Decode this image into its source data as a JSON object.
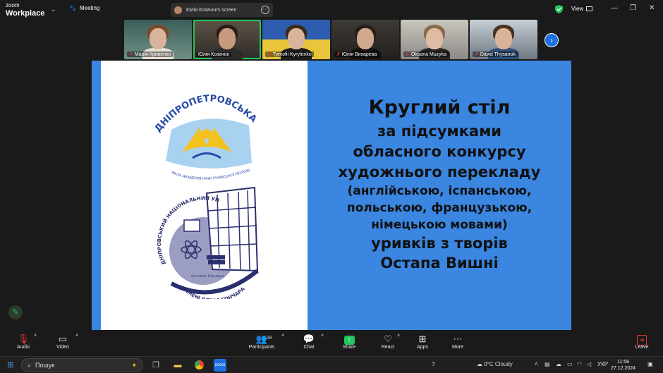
{
  "app": {
    "brand_top": "zoom",
    "brand_bottom": "Workplace",
    "meeting_label": "Meeting"
  },
  "screen_share": {
    "label": "Юлія Козачок's screen"
  },
  "top_right": {
    "view_label": "View"
  },
  "participants": [
    {
      "name": "Марія Кривенко",
      "muted": true
    },
    {
      "name": "Юлія Козачок",
      "muted": false
    },
    {
      "name": "Tymofii Kyrylenko",
      "muted": true
    },
    {
      "name": "Юлія Вихарева",
      "muted": true
    },
    {
      "name": "Oksana Muzyka",
      "muted": true
    },
    {
      "name": "David Thysanok",
      "muted": true
    }
  ],
  "slide": {
    "line1": "Круглий стіл",
    "line2": "за підсумками",
    "line3": "обласного конкурсу",
    "line4": "художнього перекладу",
    "line5": "(англійською, іспанською,",
    "line6": "польською, французькою,",
    "line7": "німецькою мовами)",
    "line8": "уривків з творів",
    "line9": "Остапа Вишні",
    "logo1_title": "ДНІПРОПЕТРОВСЬКА",
    "logo1_sub": "МАЛА АКАДЕМІЯ НАУК УЧНІВСЬКОЇ МОЛОДІ",
    "logo2_top": "ДНІПРОВСЬКИЙ НАЦІОНАЛЬНИЙ УНІВЕРСИТЕТ",
    "logo2_bottom": "ІМЕНІ ОЛЕСЯ ГОНЧАРА",
    "logo2_motto": "Docendo Discimus"
  },
  "toolbar": {
    "audio": "Audio",
    "video": "Video",
    "participants": "Participants",
    "participants_count": "38",
    "chat": "Chat",
    "share": "Share",
    "react": "React",
    "apps": "Apps",
    "more": "More",
    "leave": "Leave"
  },
  "taskbar": {
    "search_placeholder": "Пошук",
    "weather": "0°C  Cloudy",
    "language": "УКР",
    "time": "11:58",
    "date": "27.12.2024"
  }
}
